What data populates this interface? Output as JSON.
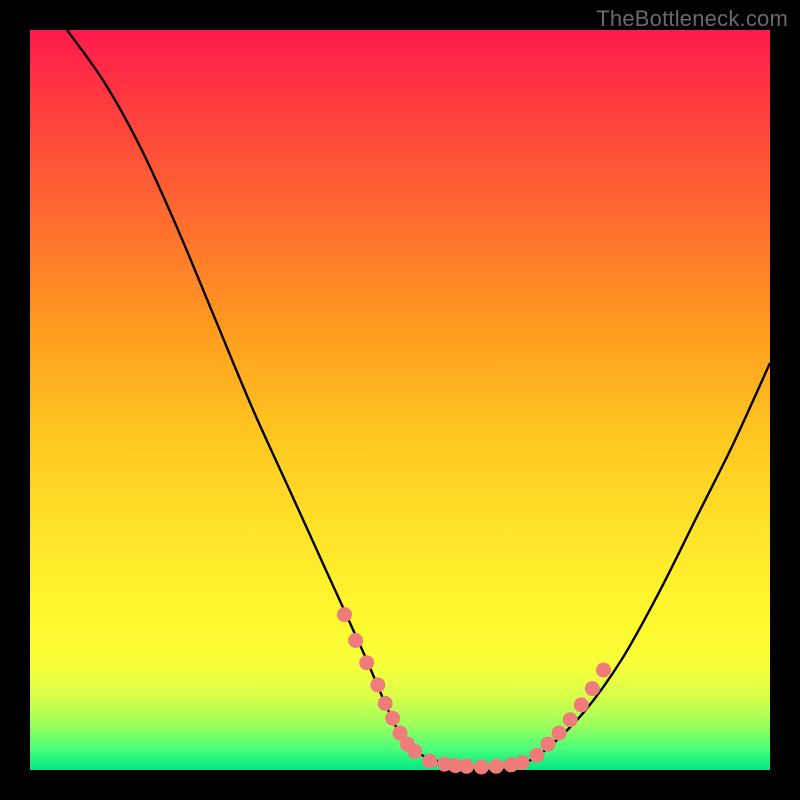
{
  "watermark": "TheBottleneck.com",
  "colors": {
    "page_bg": "#000000",
    "gradient_top": "#ff1a4d",
    "gradient_bottom": "#00e887",
    "curve_stroke": "#000000",
    "dot_fill": "#ef7c7a",
    "dot_stroke": "#7a2f2f"
  },
  "chart_data": {
    "type": "line",
    "title": "",
    "xlabel": "",
    "ylabel": "",
    "xlim": [
      0,
      100
    ],
    "ylim": [
      0,
      100
    ],
    "grid": false,
    "legend": false,
    "annotations": [
      "TheBottleneck.com"
    ],
    "series": [
      {
        "name": "bottleneck-curve",
        "x": [
          5,
          10,
          15,
          20,
          25,
          30,
          35,
          40,
          45,
          48,
          50,
          53,
          56,
          60,
          64,
          67,
          70,
          75,
          80,
          85,
          90,
          95,
          100
        ],
        "y": [
          100,
          93,
          84,
          73,
          61,
          49,
          38,
          27,
          16,
          9,
          5,
          2,
          1,
          0,
          0,
          1,
          3,
          8,
          15,
          24,
          34,
          44,
          55
        ]
      }
    ],
    "markers": [
      {
        "name": "dots-left-slope",
        "x": [
          42.5,
          44.0,
          45.5,
          47.0,
          48.0,
          49.0,
          50.0,
          51.0,
          52.0
        ],
        "y": [
          21.0,
          17.5,
          14.5,
          11.5,
          9.0,
          7.0,
          5.0,
          3.5,
          2.5
        ]
      },
      {
        "name": "dots-valley",
        "x": [
          54.0,
          56.0,
          57.5,
          59.0,
          61.0,
          63.0,
          65.0,
          66.5
        ],
        "y": [
          1.2,
          0.8,
          0.6,
          0.5,
          0.4,
          0.5,
          0.7,
          1.0
        ]
      },
      {
        "name": "dots-right-slope",
        "x": [
          68.5,
          70.0,
          71.5,
          73.0,
          74.5,
          76.0,
          77.5
        ],
        "y": [
          2.0,
          3.5,
          5.0,
          6.8,
          8.8,
          11.0,
          13.5
        ]
      }
    ]
  }
}
